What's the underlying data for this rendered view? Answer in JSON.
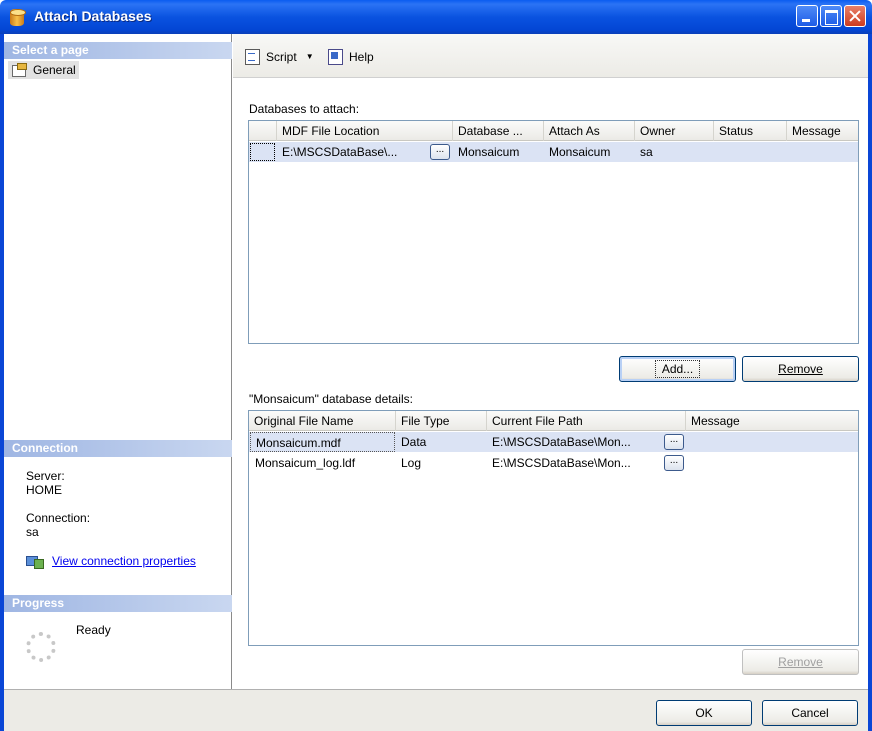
{
  "window": {
    "title": "Attach Databases"
  },
  "left": {
    "select_page_header": "Select a page",
    "pages": [
      {
        "label": "General"
      }
    ],
    "connection_header": "Connection",
    "server_label": "Server:",
    "server_value": "HOME",
    "connection_label": "Connection:",
    "connection_value": "sa",
    "view_props_link": "View connection properties",
    "progress_header": "Progress",
    "progress_status": "Ready"
  },
  "toolbar": {
    "script_label": "Script",
    "help_label": "Help"
  },
  "databases": {
    "label": "Databases to attach:",
    "columns": [
      "MDF File Location",
      "Database ...",
      "Attach As",
      "Owner",
      "Status",
      "Message"
    ],
    "rows": [
      {
        "mdf": "E:\\MSCSDataBase\\...",
        "database": "Monsaicum",
        "attach_as": "Monsaicum",
        "owner": "sa",
        "status": "",
        "message": ""
      }
    ],
    "add_label": "Add...",
    "remove_label": "Remove"
  },
  "details": {
    "label": "\"Monsaicum\" database details:",
    "columns": [
      "Original File Name",
      "File Type",
      "Current File Path",
      "Message"
    ],
    "rows": [
      {
        "name": "Monsaicum.mdf",
        "type": "Data",
        "path": "E:\\MSCSDataBase\\Mon...",
        "message": ""
      },
      {
        "name": "Monsaicum_log.ldf",
        "type": "Log",
        "path": "E:\\MSCSDataBase\\Mon...",
        "message": ""
      }
    ],
    "remove_label": "Remove"
  },
  "footer": {
    "ok_label": "OK",
    "cancel_label": "Cancel"
  },
  "ellipsis": "..."
}
